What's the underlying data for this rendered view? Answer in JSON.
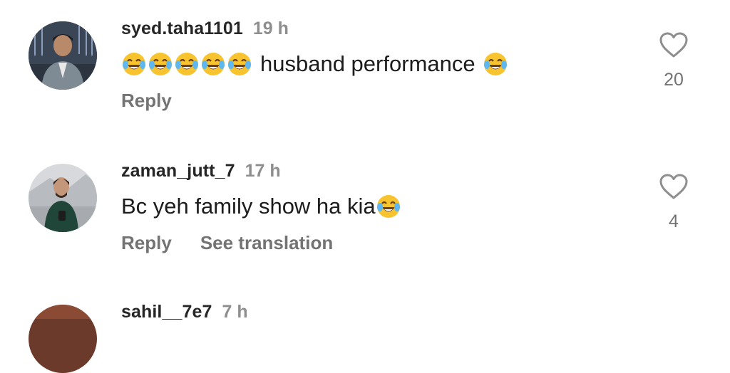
{
  "comments": [
    {
      "username": "syed.taha1101",
      "time": "19 h",
      "text_prefix_emoji_count": 5,
      "text": "husband performance",
      "text_suffix_emoji_count": 1,
      "emoji": "face-with-tears-of-joy",
      "actions": {
        "reply": "Reply"
      },
      "likes": "20"
    },
    {
      "username": "zaman_jutt_7",
      "time": "17 h",
      "text": "Bc yeh family show ha kia",
      "text_suffix_emoji_count": 1,
      "emoji": "face-with-tears-of-joy",
      "actions": {
        "reply": "Reply",
        "see_translation": "See translation"
      },
      "likes": "4"
    },
    {
      "username": "sahil__7e7",
      "time": "7 h"
    }
  ],
  "icons": {
    "like": "heart-outline-icon"
  },
  "colors": {
    "username": "#262626",
    "secondary": "#8e8e8e",
    "action": "#737373"
  }
}
